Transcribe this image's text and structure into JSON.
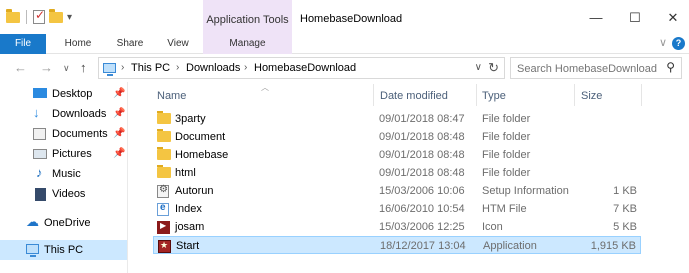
{
  "window": {
    "title": "HomebaseDownload",
    "context_tab_group": "Application Tools",
    "minimize": "—",
    "maximize": "☐",
    "close": "✕"
  },
  "ribbon": {
    "tabs": [
      "File",
      "Home",
      "Share",
      "View",
      "Manage"
    ],
    "collapse_glyph": "∨",
    "help_glyph": "?"
  },
  "address": {
    "back": "←",
    "forward": "→",
    "recent": "∨",
    "up": "↑",
    "crumbs": [
      "This PC",
      "Downloads",
      "HomebaseDownload"
    ],
    "refresh": "↻",
    "dropdown": "∨"
  },
  "search": {
    "placeholder": "Search HomebaseDownload"
  },
  "nav": {
    "items": [
      {
        "label": "Desktop",
        "pinned": true,
        "icon": "desktop-icon"
      },
      {
        "label": "Downloads",
        "pinned": true,
        "icon": "download-icon"
      },
      {
        "label": "Documents",
        "pinned": true,
        "icon": "documents-icon"
      },
      {
        "label": "Pictures",
        "pinned": true,
        "icon": "pictures-icon"
      },
      {
        "label": "Music",
        "pinned": false,
        "icon": "music-icon"
      },
      {
        "label": "Videos",
        "pinned": false,
        "icon": "videos-icon"
      },
      {
        "label": "OneDrive",
        "pinned": false,
        "icon": "cloud-icon"
      },
      {
        "label": "This PC",
        "pinned": false,
        "icon": "pc-icon",
        "selected": true
      }
    ]
  },
  "columns": [
    "Name",
    "Date modified",
    "Type",
    "Size"
  ],
  "files": [
    {
      "name": "3party",
      "date": "09/01/2018 08:47",
      "type": "File folder",
      "size": "",
      "icon": "folder-icon"
    },
    {
      "name": "Document",
      "date": "09/01/2018 08:48",
      "type": "File folder",
      "size": "",
      "icon": "folder-icon"
    },
    {
      "name": "Homebase",
      "date": "09/01/2018 08:48",
      "type": "File folder",
      "size": "",
      "icon": "folder-icon"
    },
    {
      "name": "html",
      "date": "09/01/2018 08:48",
      "type": "File folder",
      "size": "",
      "icon": "folder-icon"
    },
    {
      "name": "Autorun",
      "date": "15/03/2006 10:06",
      "type": "Setup Information",
      "size": "1 KB",
      "icon": "setup-info-icon"
    },
    {
      "name": "Index",
      "date": "16/06/2010 10:54",
      "type": "HTM File",
      "size": "7 KB",
      "icon": "htm-file-icon"
    },
    {
      "name": "josam",
      "date": "15/03/2006 12:25",
      "type": "Icon",
      "size": "5 KB",
      "icon": "icon-file-icon"
    },
    {
      "name": "Start",
      "date": "18/12/2017 13:04",
      "type": "Application",
      "size": "1,915 KB",
      "icon": "application-icon",
      "selected": true
    }
  ]
}
